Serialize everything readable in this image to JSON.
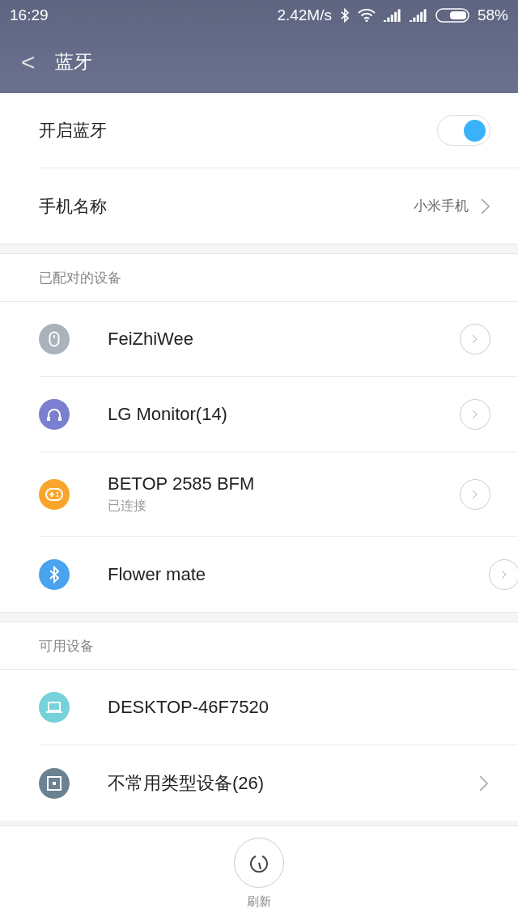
{
  "status_bar": {
    "time": "16:29",
    "speed": "2.42M/s",
    "battery": "58%"
  },
  "header": {
    "back": "<",
    "title": "蓝牙"
  },
  "settings": [
    {
      "kind": "toggle",
      "label": "开启蓝牙",
      "on": true
    },
    {
      "kind": "link",
      "label": "手机名称",
      "value": "小米手机"
    }
  ],
  "sections": [
    {
      "title": "已配对的设备",
      "devices": [
        {
          "name": "FeiZhiWee",
          "kind": "mouse",
          "color": "#aab3bb",
          "trailing": {
            "kind": "circle"
          }
        },
        {
          "name": "LG Monitor(14)",
          "kind": "headphones",
          "color": "#7b7fcf",
          "trailing": {
            "kind": "circle"
          }
        },
        {
          "name": "BETOP 2585 BFM",
          "status": "已连接",
          "kind": "gamepad",
          "color": "#f9a52c",
          "trailing": {
            "kind": "circle"
          }
        },
        {
          "name": "Flower mate",
          "kind": "bluetooth",
          "color": "#4aa3ef",
          "trailing": {
            "kind": "circle_offset"
          }
        }
      ]
    },
    {
      "title": "可用设备",
      "devices": [
        {
          "name": "DESKTOP-46F7520",
          "kind": "laptop",
          "color": "#75d2da"
        },
        {
          "name": "不常用类型设备(26)",
          "kind": "square",
          "color": "#6a8291",
          "trailing": {
            "kind": "plain"
          }
        }
      ]
    }
  ],
  "refresh": {
    "label": "刷新"
  }
}
